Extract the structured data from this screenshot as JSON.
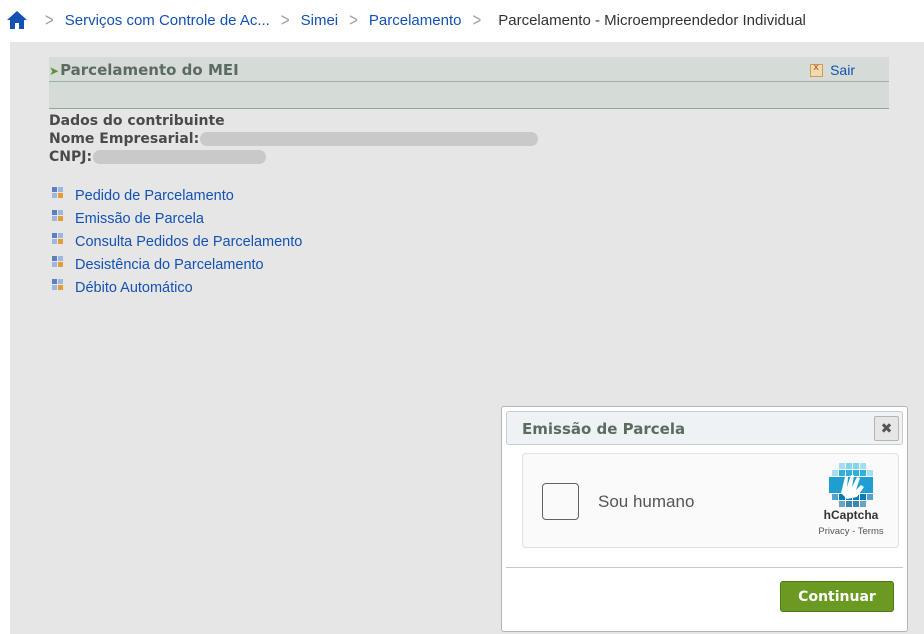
{
  "breadcrumb": {
    "home_icon": "home-icon",
    "items": [
      {
        "label": "Serviços com Controle de Ac..."
      },
      {
        "label": "Simei"
      },
      {
        "label": "Parcelamento"
      }
    ],
    "current": "Parcelamento - Microempreendedor Individual"
  },
  "panel": {
    "title": "Parcelamento do MEI",
    "exit_label": "Sair"
  },
  "contributor": {
    "heading": "Dados do contribuinte",
    "name_label": "Nome Empresarial:",
    "cnpj_label": "CNPJ:"
  },
  "menu": {
    "items": [
      {
        "label": "Pedido de Parcelamento"
      },
      {
        "label": "Emissão de Parcela"
      },
      {
        "label": "Consulta Pedidos de Parcelamento"
      },
      {
        "label": "Desistência do Parcelamento"
      },
      {
        "label": "Débito Automático"
      }
    ]
  },
  "dialog": {
    "title": "Emissão de Parcela",
    "captcha": {
      "label": "Sou humano",
      "brand": "hCaptcha",
      "links": "Privacy - Terms"
    },
    "continue_label": "Continuar"
  },
  "colors": {
    "link": "#1351b4",
    "background": "#e6e6e6",
    "button": "#6b9a22"
  }
}
